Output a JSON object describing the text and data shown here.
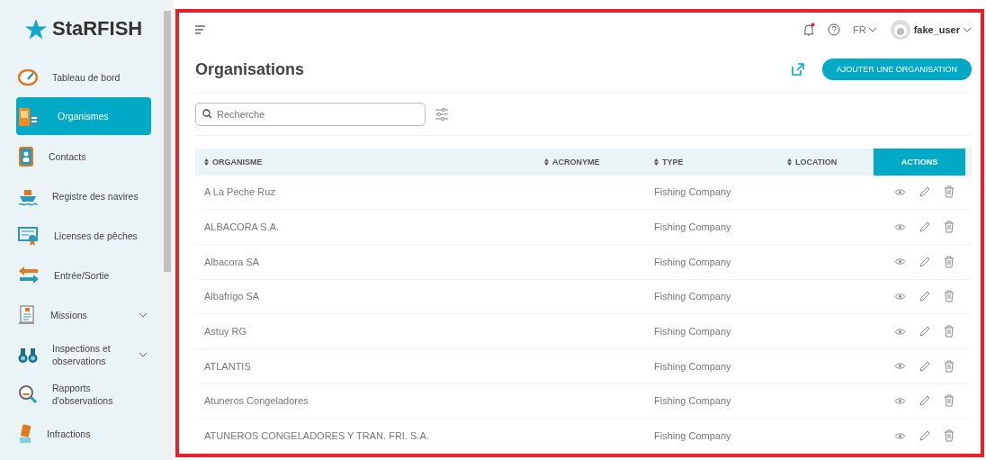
{
  "brand": "StaRFISH",
  "sidebar": {
    "items": [
      {
        "label": "Tableau de bord",
        "selected": false,
        "kind": "link"
      },
      {
        "label": "Organismes",
        "selected": true,
        "kind": "link"
      },
      {
        "label": "Contacts",
        "selected": false,
        "kind": "link"
      },
      {
        "label": "Registre des navires",
        "selected": false,
        "kind": "link"
      },
      {
        "label": "Licenses de pêches",
        "selected": false,
        "kind": "link"
      },
      {
        "label": "Entrée/Sortie",
        "selected": false,
        "kind": "link"
      },
      {
        "label": "Missions",
        "selected": false,
        "kind": "group"
      },
      {
        "label": "Inspections et observations",
        "selected": false,
        "kind": "group"
      },
      {
        "label": "Rapports d'observations",
        "selected": false,
        "kind": "link"
      },
      {
        "label": "Infractions",
        "selected": false,
        "kind": "link"
      }
    ]
  },
  "topbar": {
    "language": "FR",
    "user": "fake_user",
    "notification_unread": true
  },
  "page": {
    "title": "Organisations",
    "add_button": "AJOUTER UNE ORGANISATION"
  },
  "search": {
    "placeholder": "Recherche"
  },
  "table": {
    "columns": [
      {
        "label": "ORGANISME",
        "sortable": true
      },
      {
        "label": "ACRONYME",
        "sortable": true
      },
      {
        "label": "TYPE",
        "sortable": true
      },
      {
        "label": "LOCATION",
        "sortable": true
      },
      {
        "label": "ACTIONS",
        "sortable": false
      }
    ],
    "rows": [
      {
        "organisme": "A La Peche Ruz",
        "type": "Fishing Company"
      },
      {
        "organisme": "ALBACORA S.A.",
        "type": "Fishing Company"
      },
      {
        "organisme": "Albacora SA",
        "type": "Fishing Company"
      },
      {
        "organisme": "Albafrigo SA",
        "type": "Fishing Company"
      },
      {
        "organisme": "Astuy RG",
        "type": "Fishing Company"
      },
      {
        "organisme": "ATLANTIS",
        "type": "Fishing Company"
      },
      {
        "organisme": "Atuneros Congeladores",
        "type": "Fishing Company"
      },
      {
        "organisme": "ATUNEROS CONGELADORES Y TRAN. FRI. S.A.",
        "type": "Fishing Company"
      }
    ]
  }
}
